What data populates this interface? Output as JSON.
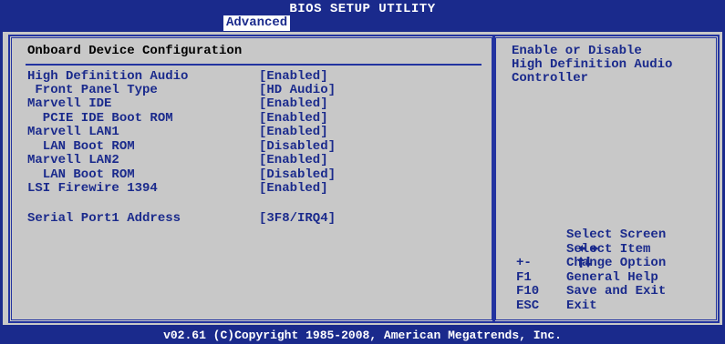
{
  "title": "BIOS SETUP UTILITY",
  "active_tab": "Advanced",
  "section_title": "Onboard Device Configuration",
  "settings": [
    {
      "label": "High Definition Audio",
      "value": "[Enabled]"
    },
    {
      "label": " Front Panel Type",
      "value": "[HD Audio]"
    },
    {
      "label": "Marvell IDE",
      "value": "[Enabled]"
    },
    {
      "label": "  PCIE IDE Boot ROM",
      "value": "[Enabled]"
    },
    {
      "label": "Marvell LAN1",
      "value": "[Enabled]"
    },
    {
      "label": "  LAN Boot ROM",
      "value": "[Disabled]"
    },
    {
      "label": "Marvell LAN2",
      "value": "[Enabled]"
    },
    {
      "label": "  LAN Boot ROM",
      "value": "[Disabled]"
    },
    {
      "label": "LSI Firewire 1394",
      "value": "[Enabled]"
    },
    {
      "label": "Serial Port1 Address",
      "value": "[3F8/IRQ4]"
    }
  ],
  "help_text": {
    "line1": "Enable or Disable",
    "line2": "High Definition Audio",
    "line3": "Controller"
  },
  "keys": [
    {
      "key_icon": "left-right-arrows-icon",
      "desc": "Select Screen"
    },
    {
      "key_icon": "up-down-arrows-icon",
      "desc": "Select Item"
    },
    {
      "key": "+-",
      "desc": "Change Option"
    },
    {
      "key": "F1",
      "desc": "General Help"
    },
    {
      "key": "F10",
      "desc": "Save and Exit"
    },
    {
      "key": "ESC",
      "desc": "Exit"
    }
  ],
  "footer": "v02.61 (C)Copyright 1985-2008, American Megatrends, Inc.",
  "colors": {
    "background": "#1a2a8c",
    "panel": "#c8c8c8",
    "text": "#1a2a8c",
    "highlight": "#ffffff"
  }
}
